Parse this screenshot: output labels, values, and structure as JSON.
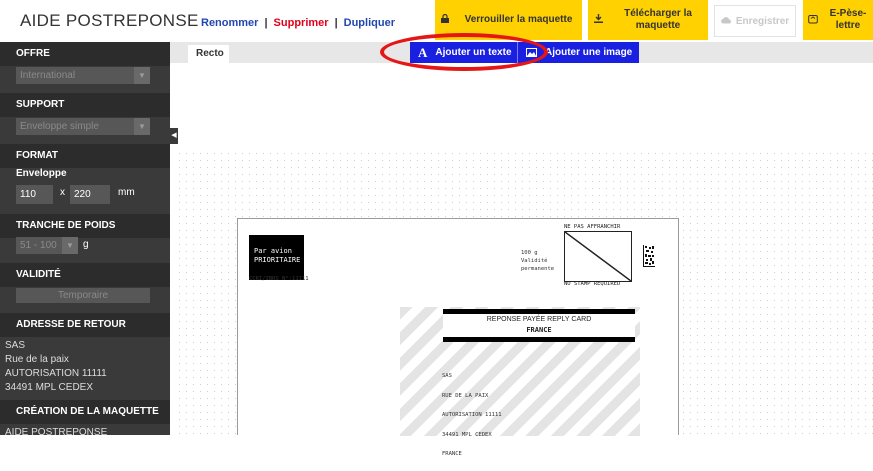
{
  "header": {
    "app_title": "AIDE POSTREPONSE",
    "actions": {
      "rename": "Renommer",
      "delete": "Supprimer",
      "duplicate": "Dupliquer",
      "separator": "|"
    },
    "lock_label": "Verrouiller la maquette",
    "download_label": "Télécharger la maquette",
    "save_label": "Enregistrer",
    "epese_label": "E-Pèse-lettre"
  },
  "sidebar": {
    "offre": {
      "title": "OFFRE",
      "value": "International"
    },
    "support": {
      "title": "SUPPORT",
      "value": "Enveloppe simple"
    },
    "format": {
      "title": "FORMAT",
      "type": "Enveloppe",
      "width": "110",
      "times": "x",
      "height": "220",
      "unit": "mm"
    },
    "tranche": {
      "title": "TRANCHE DE POIDS",
      "value": "51 - 100",
      "unit": "g"
    },
    "validite": {
      "title": "VALIDITÉ",
      "button": "Temporaire"
    },
    "adresse": {
      "title": "ADRESSE DE RETOUR",
      "lines": [
        "SAS",
        "Rue de la paix",
        "AUTORISATION 11111",
        "34491 MPL CEDEX"
      ]
    },
    "creation": {
      "title": "CRÉATION DE LA MAQUETTE",
      "value": "AIDE POSTREPONSE"
    }
  },
  "canvas": {
    "tab": "Recto",
    "add_text": "Ajouter un texte",
    "add_image": "Ajouter une image"
  },
  "envelope": {
    "airmail_line1": "Par avion",
    "airmail_line2": "PRIORITAIRE",
    "ccri": "CCRI/IBRS N°:11111",
    "weight_lines": [
      "100 g",
      "Validité",
      "permanente"
    ],
    "no_stamp_top": "NE PAS AFFRANCHIR",
    "no_stamp_bottom": "NO STAMP REQUIRED",
    "reply_title": "REPONSE PAYÉE REPLY CARD",
    "reply_country": "FRANCE",
    "dest_lines": [
      "SAS",
      "RUE DE LA PAIX",
      "AUTORISATION 11111",
      "34491 MPL CEDEX",
      "FRANCE"
    ]
  },
  "colors": {
    "accent_yellow": "#ffd100",
    "action_blue": "#2046b0",
    "delete_red": "#e0001a",
    "tool_blue": "#1a20e0",
    "highlight_red": "#e51616",
    "sidebar_bg": "#3a3a3a"
  },
  "icons": {
    "lock": "lock-icon",
    "download": "download-icon",
    "save": "cloud-icon",
    "epese": "scale-icon",
    "text": "text-icon",
    "image": "image-icon"
  }
}
